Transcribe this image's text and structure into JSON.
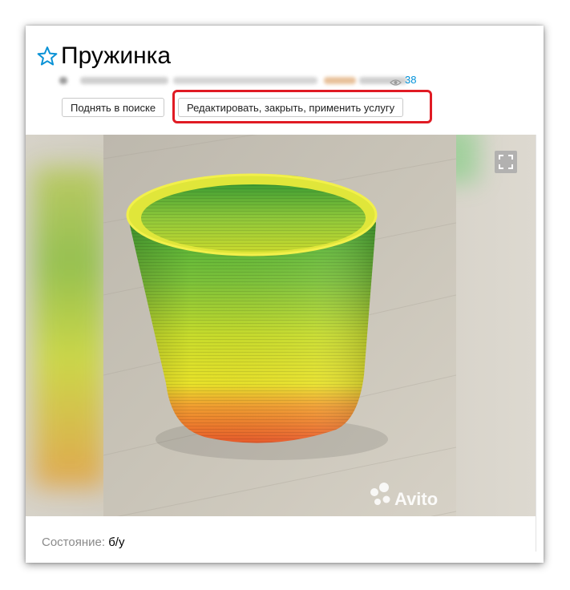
{
  "listing": {
    "title": "Пружинка",
    "views": "38"
  },
  "buttons": {
    "raise_label": "Поднять в поиске",
    "edit_label": "Редактировать, закрыть, применить услугу"
  },
  "photo": {
    "watermark": "Avito"
  },
  "details": {
    "condition_label": "Состояние:",
    "condition_value": "б/у"
  },
  "icons": {
    "favorite": "star-outline-icon",
    "views": "eye-icon",
    "fullscreen": "fullscreen-icon"
  },
  "colors": {
    "accent_link": "#0091d9",
    "highlight": "#e01b24",
    "star": "#0a92d6"
  }
}
